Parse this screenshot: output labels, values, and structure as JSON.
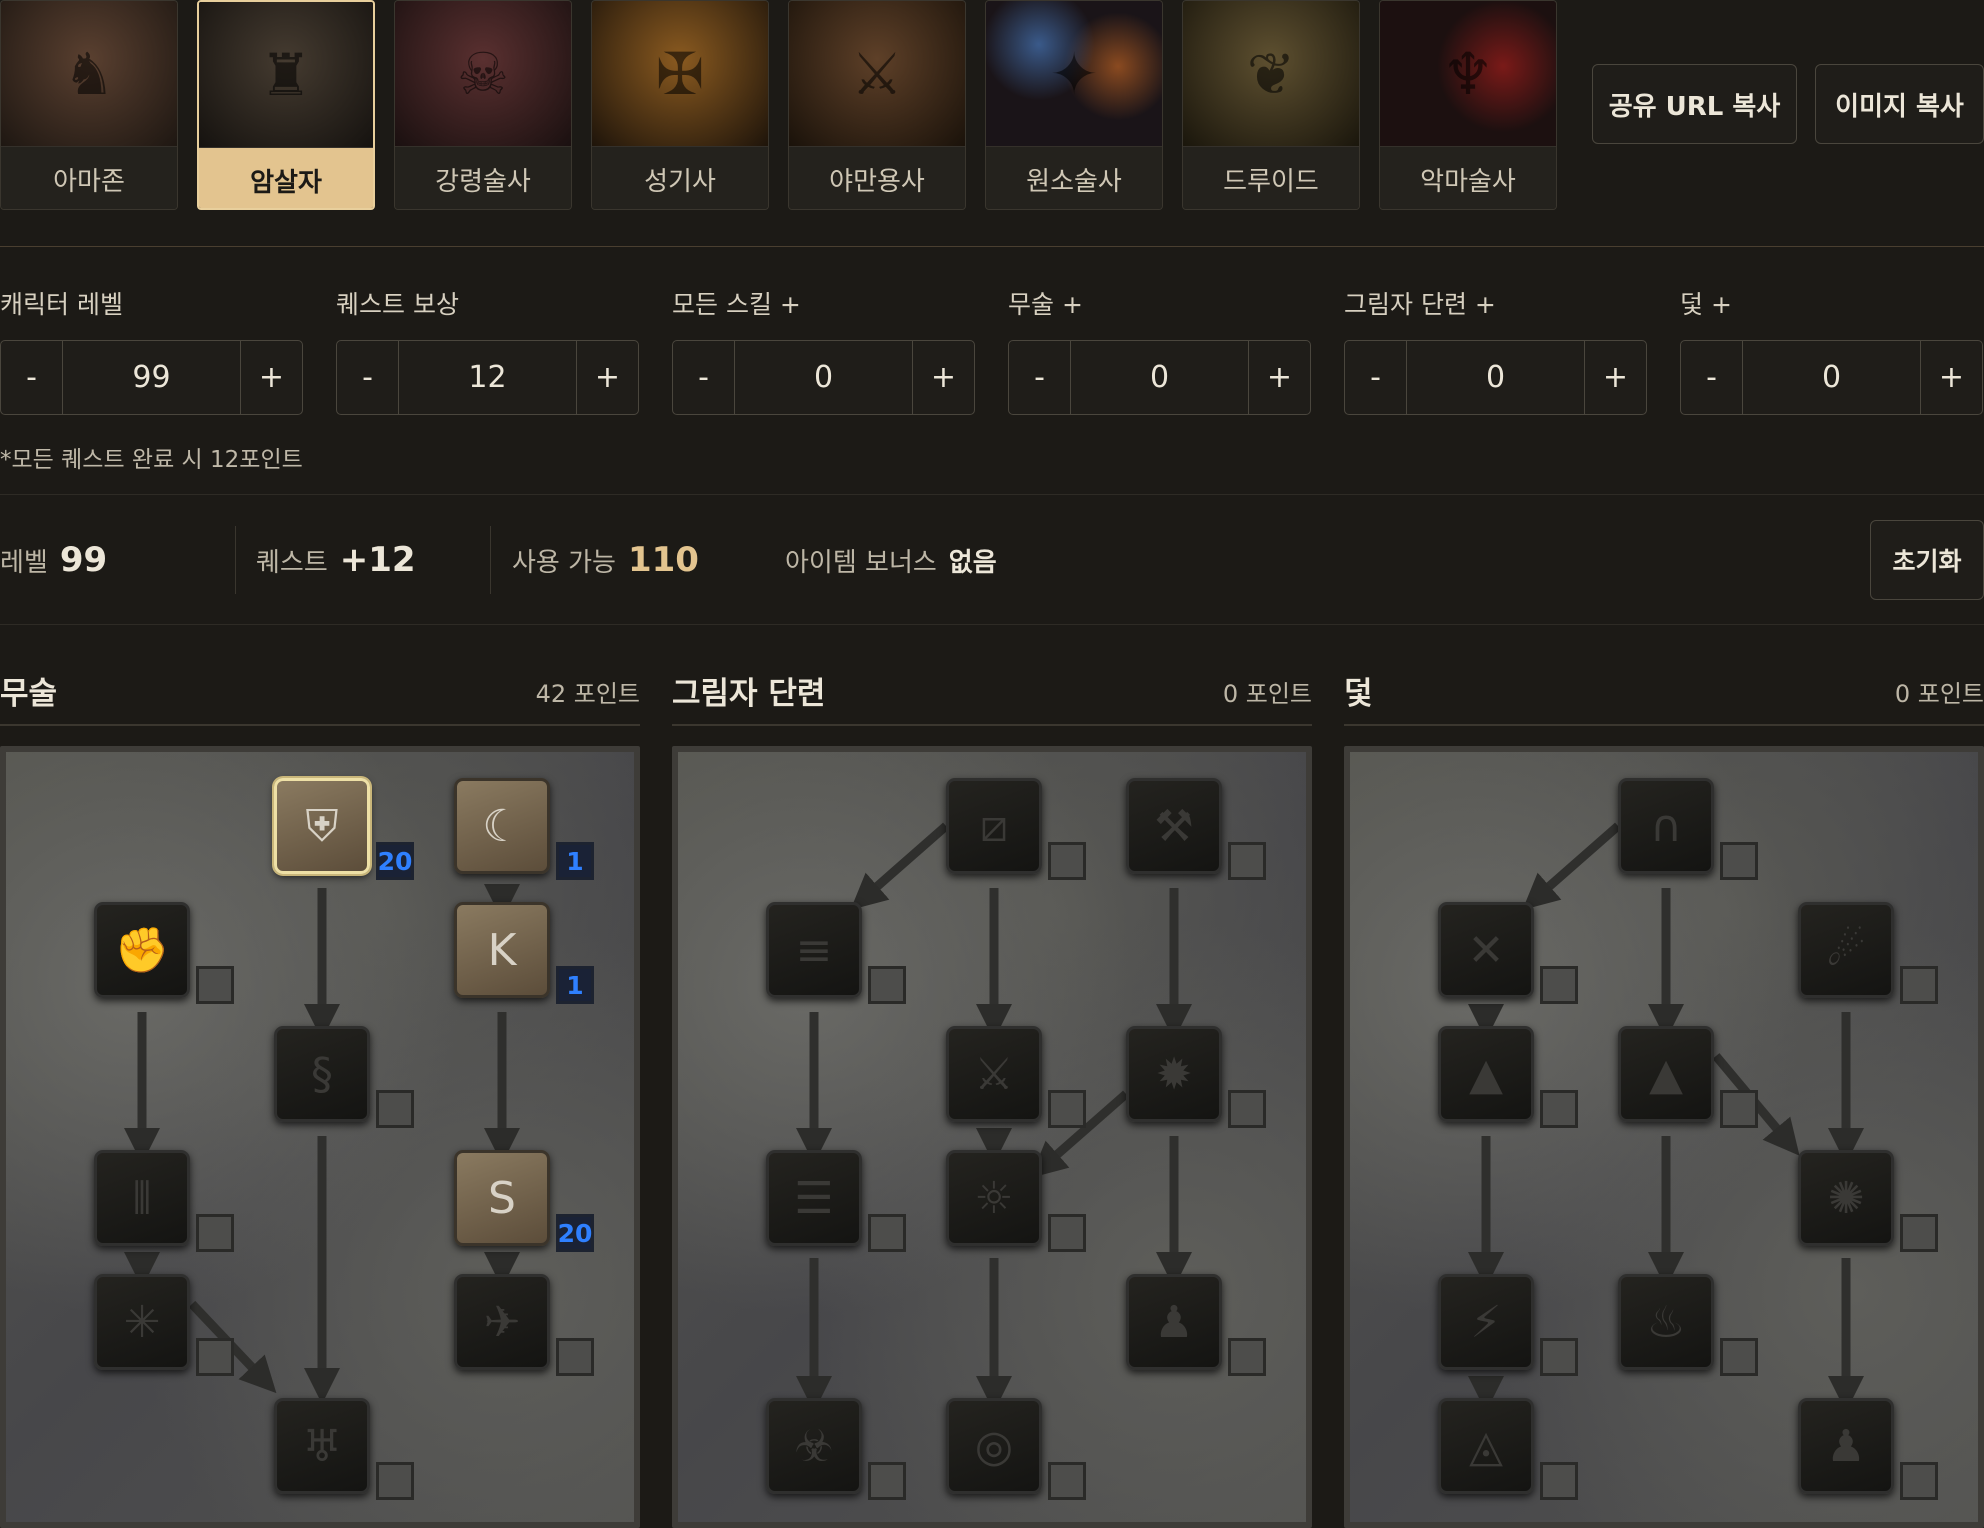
{
  "classes": [
    {
      "label": "아마존",
      "portrait_icon": "archer-icon",
      "color": "#3a2a20",
      "selected": false
    },
    {
      "label": "암살자",
      "portrait_icon": "hooded-figure-icon",
      "color": "#2a251f",
      "selected": true
    },
    {
      "label": "강령술사",
      "portrait_icon": "skull-icon",
      "color": "#3a2222",
      "selected": false
    },
    {
      "label": "성기사",
      "portrait_icon": "knight-icon",
      "color": "#4a3418",
      "selected": false
    },
    {
      "label": "야만용사",
      "portrait_icon": "warrior-icon",
      "color": "#3a2818",
      "selected": false
    },
    {
      "label": "원소술사",
      "portrait_icon": "sorceress-icon",
      "color": "#2a2540",
      "selected": false
    },
    {
      "label": "드루이드",
      "portrait_icon": "druid-icon",
      "color": "#3a3020",
      "selected": false
    },
    {
      "label": "악마술사",
      "portrait_icon": "demon-icon",
      "color": "#3a1a18",
      "selected": false
    }
  ],
  "actions": {
    "copy_url": "공유 URL 복사",
    "copy_image": "이미지 복사",
    "reset": "초기화"
  },
  "controls": [
    {
      "label": "캐릭터 레벨",
      "value": "99"
    },
    {
      "label": "퀘스트 보상",
      "value": "12"
    },
    {
      "label": "모든 스킬 +",
      "value": "0"
    },
    {
      "label": "무술 +",
      "value": "0"
    },
    {
      "label": "그림자 단련 +",
      "value": "0"
    },
    {
      "label": "덫 +",
      "value": "0"
    }
  ],
  "stepper": {
    "minus": "-",
    "plus": "+"
  },
  "note": "*모든 퀘스트 완료 시 12포인트",
  "summary": {
    "level_label": "레벨",
    "level_value": "99",
    "quest_label": "퀘스트",
    "quest_value": "+12",
    "available_label": "사용 가능",
    "available_value": "110",
    "item_bonus_label": "아이템 보너스",
    "item_bonus_value": "없음"
  },
  "trees": [
    {
      "title": "무술",
      "points": "42 포인트",
      "skills": [
        {
          "icon": "tiger-icon",
          "points": "20",
          "active": true
        },
        {
          "icon": "dragon-claw-icon",
          "points": "1",
          "active": true
        },
        {
          "icon": "fist-icon",
          "points": "",
          "active": false
        },
        {
          "icon": "dragon-talon-icon",
          "points": "1",
          "active": true
        },
        {
          "icon": "cobra-icon",
          "points": "",
          "active": false
        },
        {
          "icon": "claws-icon",
          "points": "",
          "active": false
        },
        {
          "icon": "dragon-tail-icon",
          "points": "20",
          "active": true
        },
        {
          "icon": "blades-icon",
          "points": "",
          "active": false
        },
        {
          "icon": "dragon-wing-icon",
          "points": "",
          "active": false
        },
        {
          "icon": "phoenix-icon",
          "points": "",
          "active": false
        }
      ]
    },
    {
      "title": "그림자 단련",
      "points": "0 포인트",
      "skills": [
        {
          "icon": "claw-mastery-icon",
          "points": "",
          "active": false
        },
        {
          "icon": "psychic-hammer-icon",
          "points": "",
          "active": false
        },
        {
          "icon": "burst-speed-icon",
          "points": "",
          "active": false
        },
        {
          "icon": "weapon-block-icon",
          "points": "",
          "active": false
        },
        {
          "icon": "cloak-icon",
          "points": "",
          "active": false
        },
        {
          "icon": "mind-blast-icon",
          "points": "",
          "active": false
        },
        {
          "icon": "fade-icon",
          "points": "",
          "active": false
        },
        {
          "icon": "warrior-shadow-icon",
          "points": "",
          "active": false
        },
        {
          "icon": "venom-icon",
          "points": "",
          "active": false
        },
        {
          "icon": "master-shadow-icon",
          "points": "",
          "active": false
        }
      ]
    },
    {
      "title": "덫",
      "points": "0 포인트",
      "skills": [
        {
          "icon": "fire-blast-icon",
          "points": "",
          "active": false
        },
        {
          "icon": "shock-web-icon",
          "points": "",
          "active": false
        },
        {
          "icon": "blade-sentinel-icon",
          "points": "",
          "active": false
        },
        {
          "icon": "charged-bolt-icon",
          "points": "",
          "active": false
        },
        {
          "icon": "wake-of-fire-icon",
          "points": "",
          "active": false
        },
        {
          "icon": "blade-fury-icon",
          "points": "",
          "active": false
        },
        {
          "icon": "lightning-sentry-icon",
          "points": "",
          "active": false
        },
        {
          "icon": "inferno-icon",
          "points": "",
          "active": false
        },
        {
          "icon": "death-sentry-icon",
          "points": "",
          "active": false
        },
        {
          "icon": "blade-shield-icon",
          "points": "",
          "active": false
        }
      ]
    }
  ]
}
